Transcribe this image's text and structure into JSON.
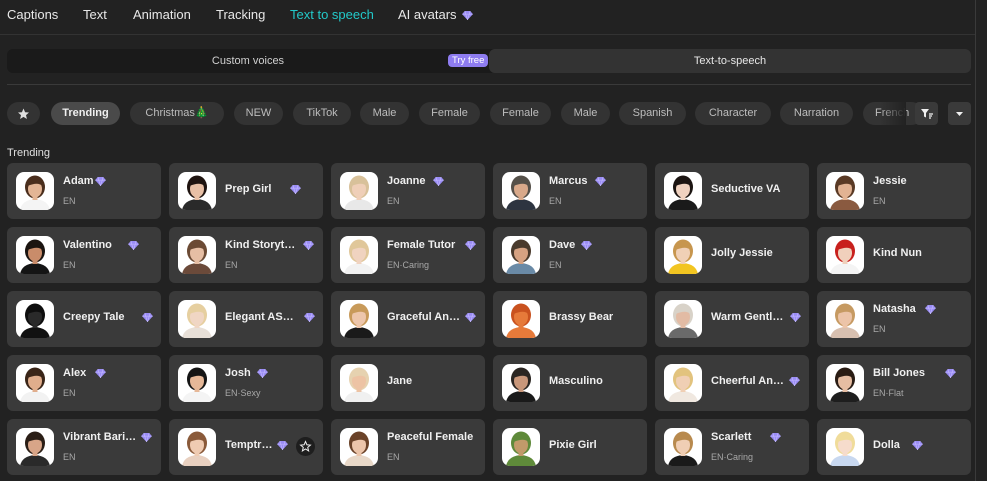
{
  "nav": {
    "tabs": [
      {
        "label": "Captions",
        "active": false,
        "premium": false
      },
      {
        "label": "Text",
        "active": false,
        "premium": false
      },
      {
        "label": "Animation",
        "active": false,
        "premium": false
      },
      {
        "label": "Tracking",
        "active": false,
        "premium": false
      },
      {
        "label": "Text to speech",
        "active": true,
        "premium": false
      },
      {
        "label": "AI avatars",
        "active": false,
        "premium": true
      }
    ]
  },
  "segment": {
    "custom_voices": "Custom voices",
    "try_free": "Try free",
    "text_to_speech": "Text-to-speech"
  },
  "filters": {
    "star_icon": "star-icon",
    "chips": [
      {
        "label": "Trending",
        "active": true
      },
      {
        "label": "Christmas🎄",
        "active": false
      },
      {
        "label": "NEW",
        "active": false
      },
      {
        "label": "TikTok",
        "active": false
      },
      {
        "label": "Male",
        "active": false
      },
      {
        "label": "Female",
        "active": false
      },
      {
        "label": "Female",
        "active": false
      },
      {
        "label": "Male",
        "active": false
      },
      {
        "label": "Spanish",
        "active": false
      },
      {
        "label": "Character",
        "active": false
      },
      {
        "label": "Narration",
        "active": false
      },
      {
        "label": "French",
        "active": false
      }
    ]
  },
  "section_title": "Trending",
  "voices": [
    {
      "name": "Adam",
      "lang": "EN",
      "premium": true,
      "avatar": {
        "skin": "#e3b595",
        "hair": "#4a2e1d",
        "bg": "#ffffff",
        "shirt": "#f4f4f4"
      }
    },
    {
      "name": "Prep Girl",
      "lang": "",
      "premium": true,
      "avatar": {
        "skin": "#e8c0a6",
        "hair": "#1f1410",
        "bg": "#ffffff",
        "shirt": "#2a2a2a"
      }
    },
    {
      "name": "Joanne",
      "lang": "EN",
      "premium": true,
      "avatar": {
        "skin": "#efcfb8",
        "hair": "#d8c19a",
        "bg": "#ffffff",
        "shirt": "#e8e8e8"
      }
    },
    {
      "name": "Marcus",
      "lang": "EN",
      "premium": true,
      "avatar": {
        "skin": "#d9a98a",
        "hair": "#555049",
        "bg": "#ffffff",
        "shirt": "#2d3440"
      }
    },
    {
      "name": "Seductive VA",
      "lang": "",
      "premium": false,
      "avatar": {
        "skin": "#f0d2c0",
        "hair": "#1c1512",
        "bg": "#ffffff",
        "shirt": "#1a1a1a"
      }
    },
    {
      "name": "Jessie",
      "lang": "EN",
      "premium": false,
      "avatar": {
        "skin": "#e2b393",
        "hair": "#5a3a25",
        "bg": "#ffffff",
        "shirt": "#8a5a40"
      }
    },
    {
      "name": "Valentino",
      "lang": "EN",
      "premium": true,
      "avatar": {
        "skin": "#c98c6a",
        "hair": "#1a1410",
        "bg": "#ffffff",
        "shirt": "#151515"
      }
    },
    {
      "name": "Kind Storyt…",
      "lang": "EN",
      "premium": true,
      "avatar": {
        "skin": "#e6bea4",
        "hair": "#6b4a34",
        "bg": "#ffffff",
        "shirt": "#6b4a3a"
      }
    },
    {
      "name": "Female Tutor",
      "lang": "EN·Caring",
      "premium": true,
      "avatar": {
        "skin": "#f0d3c0",
        "hair": "#e0c79a",
        "bg": "#ffffff",
        "shirt": "#f2f2f2"
      }
    },
    {
      "name": "Dave",
      "lang": "EN",
      "premium": true,
      "avatar": {
        "skin": "#d6a282",
        "hair": "#4a3a2c",
        "bg": "#ffffff",
        "shirt": "#6a8aa6"
      }
    },
    {
      "name": "Jolly Jessie",
      "lang": "",
      "premium": false,
      "avatar": {
        "skin": "#f0d0b6",
        "hair": "#c7964e",
        "bg": "#ffffff",
        "shirt": "#f2c521"
      }
    },
    {
      "name": "Kind Nun",
      "lang": "",
      "premium": false,
      "avatar": {
        "skin": "#f0d0bc",
        "hair": "#c8201d",
        "bg": "#ffffff",
        "shirt": "#f4f4f4"
      }
    },
    {
      "name": "Creepy Tale",
      "lang": "",
      "premium": true,
      "avatar": {
        "skin": "#2a2a2a",
        "hair": "#0e0e0e",
        "bg": "#ffffff",
        "shirt": "#111111"
      }
    },
    {
      "name": "Elegant AS…",
      "lang": "",
      "premium": true,
      "avatar": {
        "skin": "#f0d6c4",
        "hair": "#e6cfa0",
        "bg": "#ffffff",
        "shirt": "#e8e0d8"
      }
    },
    {
      "name": "Graceful An…",
      "lang": "",
      "premium": true,
      "avatar": {
        "skin": "#edc6ab",
        "hair": "#c89a5a",
        "bg": "#ffffff",
        "shirt": "#1a1a1a"
      }
    },
    {
      "name": "Brassy Bear",
      "lang": "",
      "premium": false,
      "avatar": {
        "skin": "#e67a3a",
        "hair": "#c9521f",
        "bg": "#ffffff",
        "shirt": "#e67a3a"
      }
    },
    {
      "name": "Warm Gentl…",
      "lang": "",
      "premium": true,
      "avatar": {
        "skin": "#e2bba4",
        "hair": "#d8d2c8",
        "bg": "#ffffff",
        "shirt": "#6a6a6a"
      }
    },
    {
      "name": "Natasha",
      "lang": "EN",
      "premium": true,
      "avatar": {
        "skin": "#ecc4a8",
        "hair": "#c69a62",
        "bg": "#ffffff",
        "shirt": "#d8c0b0"
      }
    },
    {
      "name": "Alex",
      "lang": "EN",
      "premium": true,
      "avatar": {
        "skin": "#e0ad8c",
        "hair": "#3a2518",
        "bg": "#ffffff",
        "shirt": "#f2f2f2"
      }
    },
    {
      "name": "Josh",
      "lang": "EN·Sexy",
      "premium": true,
      "avatar": {
        "skin": "#e6b898",
        "hair": "#151515",
        "bg": "#ffffff",
        "shirt": "#f4f4f4"
      }
    },
    {
      "name": "Jane",
      "lang": "",
      "premium": false,
      "avatar": {
        "skin": "#edc3a4",
        "hair": "#e6d2b0",
        "bg": "#ffffff",
        "shirt": "#f0f0f0"
      }
    },
    {
      "name": "Masculino",
      "lang": "",
      "premium": false,
      "avatar": {
        "skin": "#c9977a",
        "hair": "#2b2622",
        "bg": "#ffffff",
        "shirt": "#1a1a1a"
      }
    },
    {
      "name": "Cheerful An…",
      "lang": "",
      "premium": true,
      "avatar": {
        "skin": "#f0cfb4",
        "hair": "#e2c37e",
        "bg": "#ffffff",
        "shirt": "#f0e8e0"
      }
    },
    {
      "name": "Bill Jones",
      "lang": "EN·Flat",
      "premium": true,
      "avatar": {
        "skin": "#e6bda2",
        "hair": "#2a1c14",
        "bg": "#ffffff",
        "shirt": "#1e1e1e"
      }
    },
    {
      "name": "Vibrant Bari…",
      "lang": "EN",
      "premium": true,
      "avatar": {
        "skin": "#d8a588",
        "hair": "#2a1e16",
        "bg": "#ffffff",
        "shirt": "#2a2a2a"
      }
    },
    {
      "name": "Temptr…",
      "lang": "",
      "premium": true,
      "avatar": {
        "skin": "#efcbb2",
        "hair": "#8a5a3a",
        "bg": "#ffffff",
        "shirt": "#e8d0c0"
      }
    },
    {
      "name": "Peaceful Female",
      "lang": "EN",
      "premium": false,
      "avatar": {
        "skin": "#ecc5aa",
        "hair": "#6a4228",
        "bg": "#ffffff",
        "shirt": "#e8d8c8"
      }
    },
    {
      "name": "Pixie Girl",
      "lang": "",
      "premium": false,
      "avatar": {
        "skin": "#c29a6a",
        "hair": "#5f8a3a",
        "bg": "#ffffff",
        "shirt": "#5f8a3a"
      }
    },
    {
      "name": "Scarlett",
      "lang": "EN·Caring",
      "premium": true,
      "avatar": {
        "skin": "#f0ceb4",
        "hair": "#b88a4e",
        "bg": "#ffffff",
        "shirt": "#1a1a1a"
      }
    },
    {
      "name": "Dolla",
      "lang": "",
      "premium": true,
      "avatar": {
        "skin": "#f6dccc",
        "hair": "#f0dc9a",
        "bg": "#ffffff",
        "shirt": "#c8d8f0"
      }
    }
  ],
  "colors": {
    "accent": "#22c9c9",
    "premium": "#9a8cf5",
    "card": "#3a3a3a",
    "background": "#222222"
  }
}
